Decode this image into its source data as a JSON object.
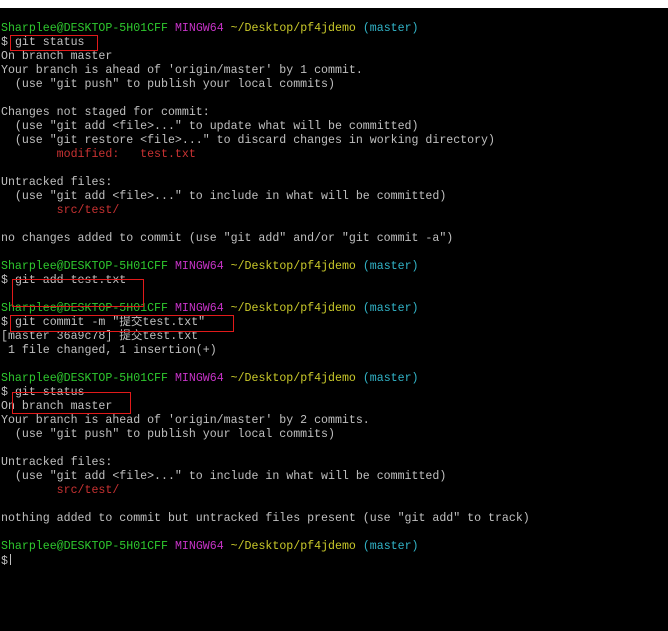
{
  "prompt": {
    "user": "Sharplee@DESKTOP-5H01CFF",
    "system": "MINGW64",
    "path": "~/Desktop/pf4jdemo",
    "branch": "(master)",
    "symbol": "$"
  },
  "colors": {
    "background": "#000000",
    "text": "#c0c0c0",
    "user": "#2ec82e",
    "system": "#c733c7",
    "path": "#c9c92a",
    "branch": "#32b4c8",
    "error": "#c83232",
    "highlight_box": "#e11a1a"
  },
  "block1": {
    "command": "git status",
    "output": [
      "On branch master",
      "Your branch is ahead of 'origin/master' by 1 commit.",
      "  (use \"git push\" to publish your local commits)",
      "",
      "Changes not staged for commit:",
      "  (use \"git add <file>...\" to update what will be committed)",
      "  (use \"git restore <file>...\" to discard changes in working directory)"
    ],
    "modified": "        modified:   test.txt",
    "untracked_header": "Untracked files:",
    "untracked_hint": "  (use \"git add <file>...\" to include in what will be committed)",
    "untracked_file": "        src/test/",
    "footer": "no changes added to commit (use \"git add\" and/or \"git commit -a\")"
  },
  "block2": {
    "command": "git add test.txt"
  },
  "block3": {
    "command": "git commit -m \"提交test.txt\"",
    "output": [
      "[master 36a9c78] 提交test.txt",
      " 1 file changed, 1 insertion(+)"
    ]
  },
  "block4": {
    "command": "git status",
    "output": [
      "On branch master",
      "Your branch is ahead of 'origin/master' by 2 commits.",
      "  (use \"git push\" to publish your local commits)"
    ],
    "untracked_header": "Untracked files:",
    "untracked_hint": "  (use \"git add <file>...\" to include in what will be committed)",
    "untracked_file": "        src/test/",
    "footer": "nothing added to commit but untracked files present (use \"git add\" to track)"
  }
}
